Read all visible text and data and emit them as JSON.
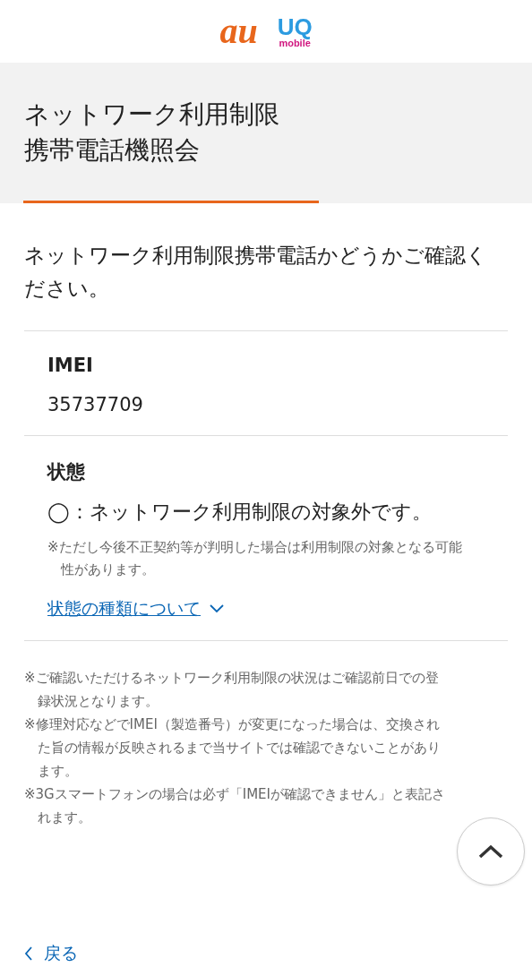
{
  "header": {
    "logos": [
      {
        "kind": "au",
        "text": "au"
      },
      {
        "kind": "uq",
        "text": "UQ",
        "subtext": "mobile"
      }
    ]
  },
  "title": {
    "lines": [
      "ネットワーク利用制限",
      "携帯電話機照会"
    ]
  },
  "intro": "ネットワーク利用制限携帯電話かどうかご確認ください。",
  "imei": {
    "label": "IMEI",
    "value": "35737709"
  },
  "status": {
    "label": "状態",
    "value": "◯：ネットワーク利用制限の対象外です。",
    "note": "※ただし今後不正契約等が判明した場合は利用制限の対象となる可能性があります。",
    "link": "状態の種類について"
  },
  "notes": [
    "※ご確認いただけるネットワーク利用制限の状況はご確認前日での登録状況となります。",
    "※修理対応などでIMEI（製造番号）が変更になった場合は、交換された旨の情報が反映されるまで当サイトでは確認できないことがあります。",
    "※3Gスマートフォンの場合は必ず「IMEIが確認できません」と表記されます。"
  ],
  "back_link": "戻る"
}
